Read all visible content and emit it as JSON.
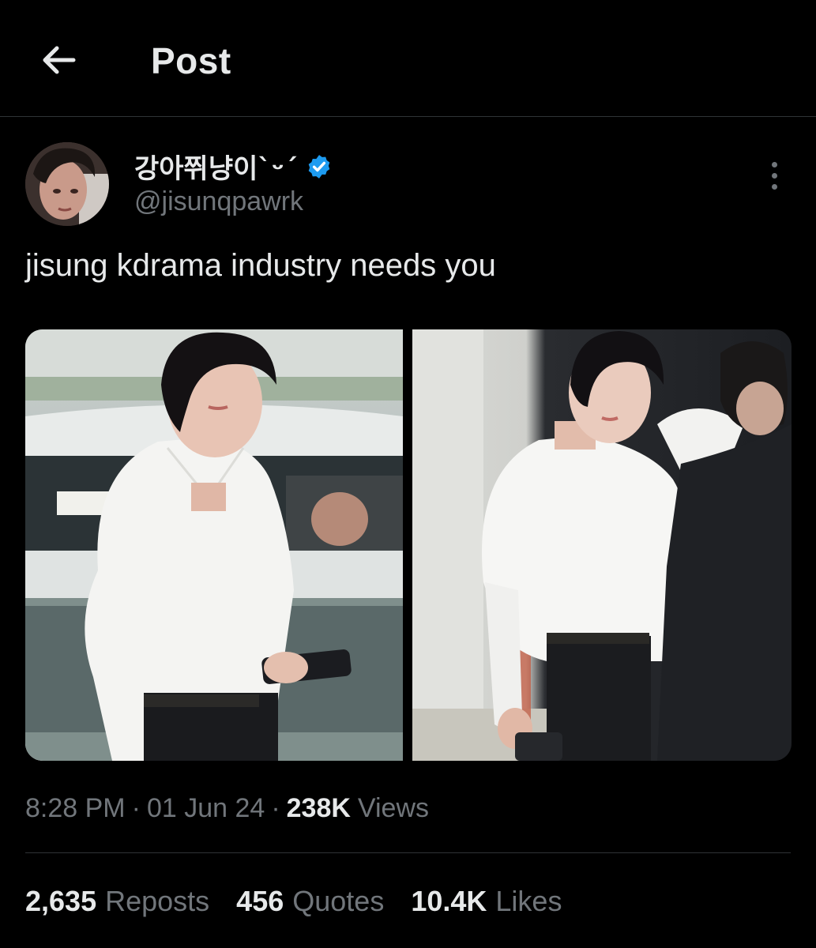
{
  "header": {
    "title": "Post",
    "back_icon": "arrow-left-icon"
  },
  "author": {
    "display_name": "강아쮜냥이ˋᵕˊ",
    "handle": "@jisunqpawrk",
    "verified_icon": "verified-badge-icon",
    "verified_color": "#1d9bf0"
  },
  "tweet": {
    "text": "jisung kdrama industry needs you",
    "media_count": 2
  },
  "meta": {
    "time": "8:28 PM",
    "separator": "·",
    "date": "01 Jun 24",
    "views_count": "238K",
    "views_label": "Views"
  },
  "stats": {
    "reposts": {
      "count": "2,635",
      "label": "Reposts"
    },
    "quotes": {
      "count": "456",
      "label": "Quotes"
    },
    "likes": {
      "count": "10.4K",
      "label": "Likes"
    }
  },
  "colors": {
    "background": "#000000",
    "text_primary": "#e7e9ea",
    "text_secondary": "#71767b",
    "divider": "#2f3336",
    "accent": "#1d9bf0"
  }
}
